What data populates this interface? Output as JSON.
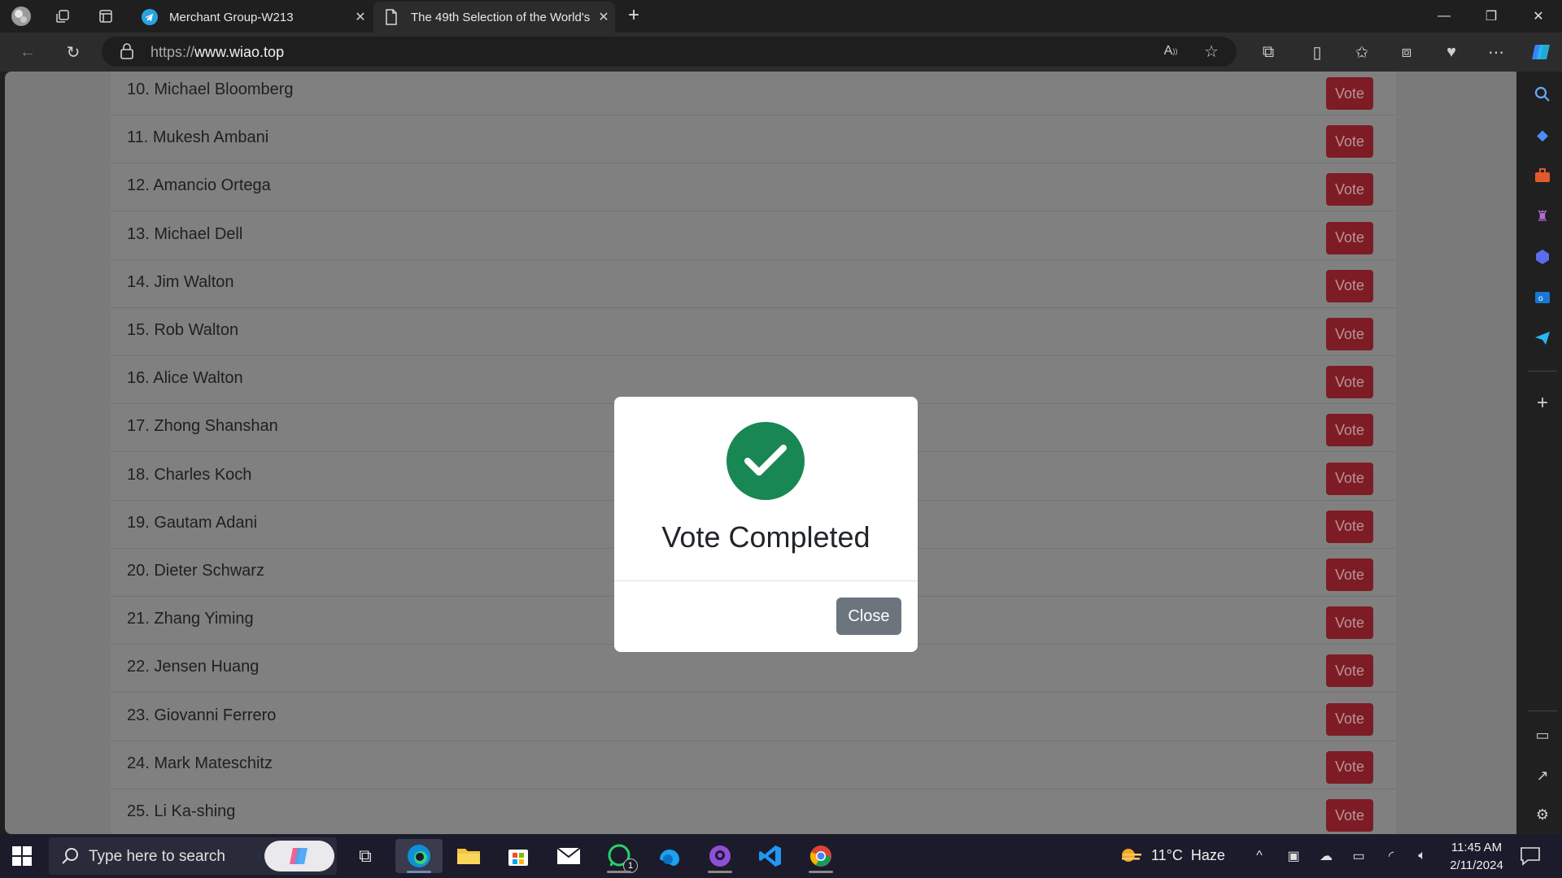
{
  "browser": {
    "tabs": [
      {
        "title": "Merchant Group-W213",
        "active": false
      },
      {
        "title": "The 49th Selection of the World's",
        "active": true
      }
    ],
    "url_prefix": "https://",
    "url_domain": "www.wiao.top"
  },
  "page": {
    "vote_label": "Vote",
    "candidates": [
      "10. Michael Bloomberg",
      "11. Mukesh Ambani",
      "12. Amancio Ortega",
      "13. Michael Dell",
      "14. Jim Walton",
      "15. Rob Walton",
      "16. Alice Walton",
      "17. Zhong Shanshan",
      "18. Charles Koch",
      "19. Gautam Adani",
      "20. Dieter Schwarz",
      "21. Zhang Yiming",
      "22. Jensen Huang",
      "23. Giovanni Ferrero",
      "24. Mark Mateschitz",
      "25. Li Ka-shing"
    ]
  },
  "modal": {
    "title": "Vote Completed",
    "close_label": "Close",
    "icon": "check-circle-icon",
    "accent": "#198754"
  },
  "taskbar": {
    "search_placeholder": "Type here to search",
    "weather": "11°C  Haze",
    "time": "11:45 AM",
    "date": "2/11/2024",
    "whatsapp_badge": "1"
  },
  "colors": {
    "vote_button": "#7d1c24",
    "overlay": "#7a7a7a"
  }
}
